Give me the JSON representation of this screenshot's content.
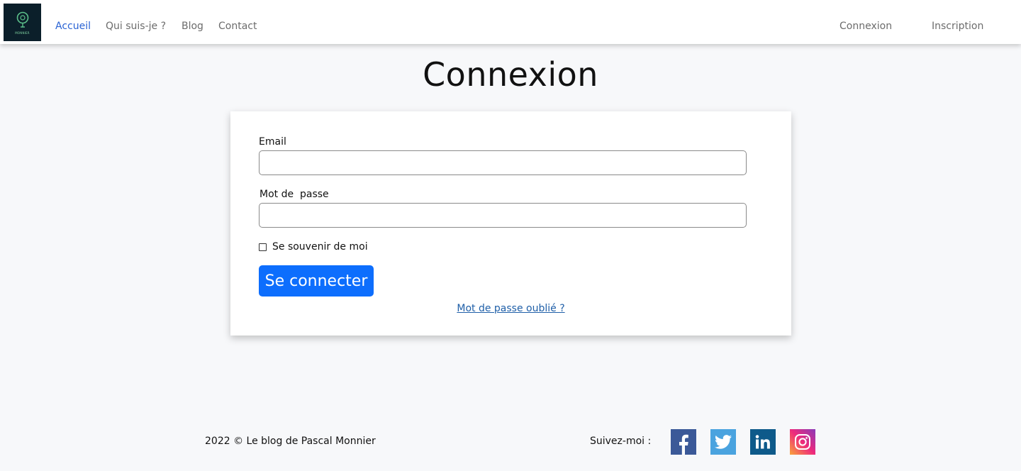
{
  "nav": {
    "logo_text": "MONNIER",
    "links": [
      "Accueil",
      "Qui suis-je ?",
      "Blog",
      "Contact"
    ],
    "active_link": "Accueil",
    "login": "Connexion",
    "register": "Inscription"
  },
  "page": {
    "title": "Connexion"
  },
  "form": {
    "email_label": "Email",
    "email_value": "",
    "password_label": "Mot de  passe",
    "password_value": "",
    "remember_label": "Se souvenir de moi",
    "remember_checked": false,
    "submit_label": "Se connecter",
    "forgot_label": "Mot de passe oublié ?"
  },
  "footer": {
    "copyright": "2022 © Le blog de Pascal Monnier",
    "follow_label": "Suivez-moi :",
    "socials": [
      "facebook-icon",
      "twitter-icon",
      "linkedin-icon",
      "instagram-icon"
    ]
  },
  "colors": {
    "accent": "#0d6efd",
    "nav_active": "#2a63d4",
    "link": "#1f5fa8",
    "background": "#f7f8fa"
  }
}
